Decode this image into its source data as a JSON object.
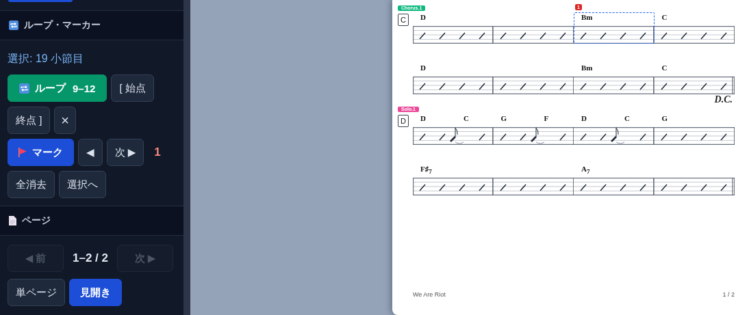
{
  "sidebar": {
    "loop_marker": {
      "title": "ループ・マーカー",
      "selection": "選択: 19 小節目",
      "loop_button": {
        "label": "ループ",
        "range": "9–12",
        "on": true
      },
      "start_button": "[ 始点",
      "end_button": "終点 ]",
      "clear_loop": "×",
      "mark_button": "マーク",
      "prev_marker": "◀",
      "next_marker": "次 ▶",
      "marker_count": "1",
      "clear_all": "全消去",
      "to_selection": "選択へ"
    },
    "page": {
      "title": "ページ",
      "prev": {
        "label": "◀ 前",
        "disabled": true
      },
      "indicator": "1–2 / 2",
      "next": {
        "label": "次 ▶",
        "disabled": true
      },
      "modes": [
        {
          "label": "単ページ",
          "selected": false
        },
        {
          "label": "見開き",
          "selected": true
        }
      ]
    }
  },
  "score": {
    "systems": [
      {
        "section": {
          "label": "Chorus.1",
          "color": "#10b981",
          "rehearsal": "C"
        },
        "final_barline": false,
        "measures": [
          {
            "kind": "slashes",
            "selected": false,
            "chords": [
              {
                "name": "D",
                "kind": "downbeat"
              }
            ]
          },
          {
            "kind": "slashes",
            "selected": false
          },
          {
            "kind": "slashes",
            "selected": true,
            "marker": "1",
            "chords": [
              {
                "name": "Bm",
                "kind": "downbeat"
              }
            ]
          },
          {
            "kind": "slashes",
            "selected": false,
            "chords": [
              {
                "name": "C",
                "kind": "downbeat"
              }
            ]
          }
        ]
      },
      {
        "final_barline": true,
        "ending": "D.C.",
        "measures": [
          {
            "kind": "slashes",
            "selected": false,
            "chords": [
              {
                "name": "D",
                "kind": "downbeat"
              }
            ]
          },
          {
            "kind": "slashes",
            "selected": false
          },
          {
            "kind": "slashes",
            "selected": false,
            "chords": [
              {
                "name": "Bm",
                "kind": "downbeat"
              }
            ]
          },
          {
            "kind": "slashes",
            "selected": false,
            "chords": [
              {
                "name": "C",
                "kind": "downbeat"
              }
            ]
          }
        ]
      },
      {
        "section": {
          "label": "Solo.1",
          "color": "#ec4899",
          "rehearsal": "D"
        },
        "final_barline": false,
        "measures": [
          {
            "kind": "push",
            "selected": false,
            "chords": [
              {
                "name": "D",
                "kind": "downbeat"
              },
              {
                "name": "C",
                "kind": "midbar"
              }
            ]
          },
          {
            "kind": "push",
            "selected": false,
            "chords": [
              {
                "name": "G",
                "kind": "downbeat"
              },
              {
                "name": "F",
                "kind": "midbar"
              }
            ]
          },
          {
            "kind": "push",
            "selected": false,
            "chords": [
              {
                "name": "D",
                "kind": "downbeat"
              },
              {
                "name": "C",
                "kind": "midbar"
              }
            ]
          },
          {
            "kind": "slashes",
            "selected": false,
            "chords": [
              {
                "name": "G",
                "kind": "downbeat"
              }
            ]
          }
        ]
      },
      {
        "final_barline": true,
        "measures": [
          {
            "kind": "slashes",
            "selected": false,
            "chords": [
              {
                "name": "F♯$_{7}$",
                "kind": "downbeat"
              }
            ]
          },
          {
            "kind": "slashes",
            "selected": false
          },
          {
            "kind": "slashes",
            "selected": false,
            "chords": [
              {
                "name": "A$_{7}$",
                "kind": "downbeat"
              }
            ]
          },
          {
            "kind": "slashes",
            "selected": false
          }
        ]
      }
    ],
    "footer": {
      "title": "We Are Riot",
      "page": "1 / 2"
    }
  }
}
